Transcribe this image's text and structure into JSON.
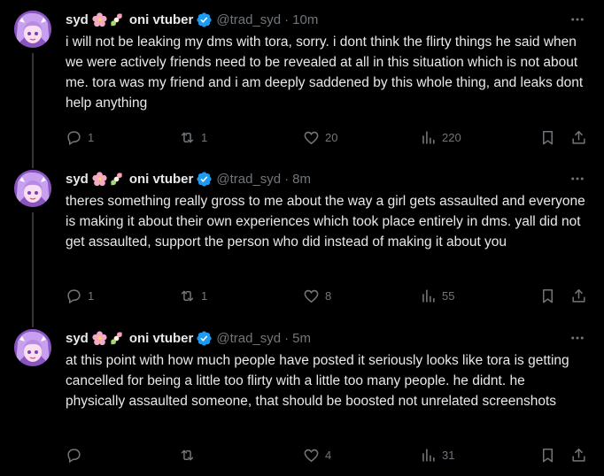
{
  "tweets": [
    {
      "display_name": "syd",
      "display_name_suffix": "oni vtuber",
      "handle": "@trad_syd",
      "time": "10m",
      "text": "i will not be leaking my dms with tora, sorry. i dont think the flirty things he said when we were actively friends need to be revealed at all in this situation which is not about me. tora was my friend and i am deeply saddened by this whole thing, and leaks dont help anything",
      "replies": "1",
      "retweets": "1",
      "likes": "20",
      "views": "220"
    },
    {
      "display_name": "syd",
      "display_name_suffix": "oni vtuber",
      "handle": "@trad_syd",
      "time": "8m",
      "text": "theres something really gross to me about the way a girl gets assaulted and everyone is making it about their own experiences which took place entirely in dms. yall did not get assaulted, support the person who did instead of making it about you",
      "replies": "1",
      "retweets": "1",
      "likes": "8",
      "views": "55"
    },
    {
      "display_name": "syd",
      "display_name_suffix": "oni vtuber",
      "handle": "@trad_syd",
      "time": "5m",
      "text": "at this point with how much people have posted it seriously looks like tora is getting cancelled for being a little too flirty with a little too many people. he didnt. he physically assaulted someone, that should be boosted not unrelated screenshots",
      "replies": "",
      "retweets": "",
      "likes": "4",
      "views": "31"
    }
  ],
  "separator": "·",
  "colors": {
    "background": "#000000",
    "text": "#e7e9ea",
    "muted": "#71767b",
    "verified": "#1d9bf0",
    "thread_line": "#333639"
  },
  "icons": [
    "avatar",
    "cherry-blossom-emoji",
    "dango-emoji",
    "verified-badge-icon",
    "more-icon",
    "reply-icon",
    "retweet-icon",
    "like-icon",
    "views-icon",
    "bookmark-icon",
    "share-icon"
  ]
}
